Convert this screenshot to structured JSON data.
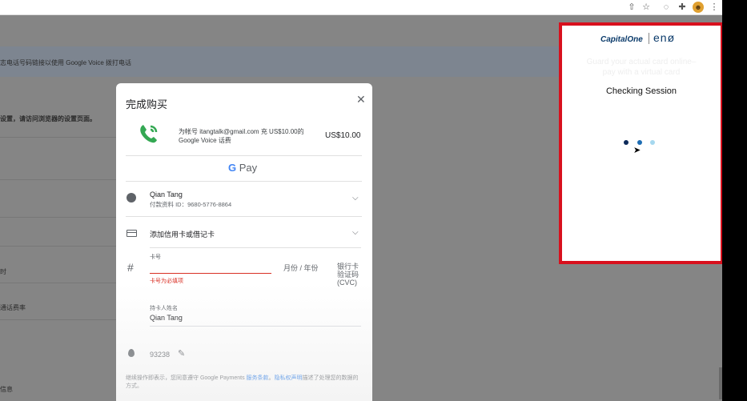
{
  "toolbar": {
    "icons": [
      "share-icon",
      "star-icon",
      "chat-extension-icon",
      "extensions-puzzle-icon",
      "profile-avatar-icon",
      "menu-dots-icon"
    ],
    "share_glyph": "⇧",
    "star_glyph": "☆",
    "chat_glyph": "◌",
    "puzzle_glyph": "✚",
    "avatar_glyph": "☻",
    "menu_glyph": "⋮"
  },
  "background_page": {
    "banner_text": "志电话号码链接以使用 Google Voice 拨打电话",
    "settings_text": "设置，请访问浏览器的设置页面。",
    "row_time": "时",
    "row_rates": "通话费率",
    "row_info": "信息"
  },
  "modal": {
    "title": "完成购买",
    "close_glyph": "✕",
    "item_description": "为帐号 itangtalk@gmail.com 充 US$10.00的 Google Voice 话费",
    "item_price": "US$10.00",
    "gpay_g": "G",
    "gpay_label": "Pay",
    "account": {
      "name": "Qian Tang",
      "payment_id": "付款资料 ID：9680-5776-8864"
    },
    "add_card_label": "添加信用卡或借记卡",
    "chevron_glyph": "⌵",
    "card_number": {
      "label": "卡号",
      "value": "",
      "error": "卡号为必填项"
    },
    "expiry_placeholder": "月份 / 年份",
    "cvc_label": "银行卡验证码 (CVC)",
    "cardholder": {
      "label": "持卡人姓名",
      "value": "Qian Tang"
    },
    "zip": "93238",
    "edit_glyph": "✎",
    "terms_prefix": "继续操作即表示，您同意遵守 Google Payments ",
    "terms_link1": "服务条款",
    "terms_sep": "。",
    "terms_link2": "隐私权声明",
    "terms_suffix": "描述了处理您的数据的方式。"
  },
  "eno_popup": {
    "brand_capitalone": "CapitalOne",
    "brand_eno": "enø",
    "ghost_line1": "Guard your actual card online–",
    "ghost_line2": "pay with a virtual card",
    "status_text": "Checking Session",
    "dot_colors": [
      "#0d2a5a",
      "#1e6db3",
      "#a6d8ef"
    ],
    "border_color": "#d8101d"
  },
  "colors": {
    "error": "#d93025",
    "link": "#1a73e8",
    "gv_green": "#34a853"
  }
}
